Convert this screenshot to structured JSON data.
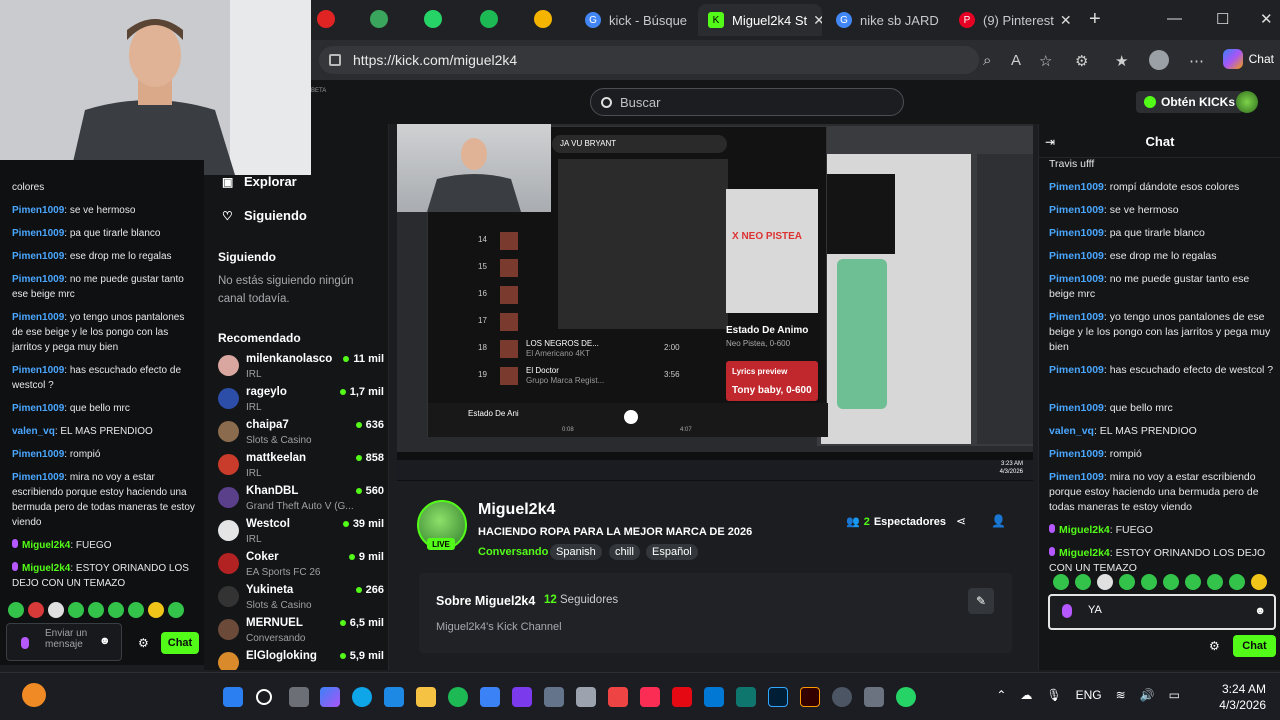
{
  "browser": {
    "tabs": [
      {
        "label": "kick - Búsque",
        "active": false
      },
      {
        "label": "Miguel2k4 St",
        "active": true
      },
      {
        "label": "nike sb JARD",
        "active": false
      },
      {
        "label": "(9) Pinterest",
        "active": false
      }
    ],
    "url": "https://kick.com/miguel2k4",
    "copilot_label": "Chat"
  },
  "header": {
    "beta": "BETA",
    "search_placeholder": "Buscar",
    "kicks_button": "Obtén KICKs"
  },
  "sidebar": {
    "explore": "Explorar",
    "following_link": "Siguiendo",
    "following_title": "Siguiendo",
    "no_following": "No estás siguiendo ningún canal todavía.",
    "recommended_title": "Recomendado",
    "recommended": [
      {
        "name": "milenkanolasco",
        "category": "IRL",
        "viewers": "11 mil",
        "color": "#d9a7a0"
      },
      {
        "name": "rageylo",
        "category": "IRL",
        "viewers": "1,7 mil",
        "color": "#2c4ea8"
      },
      {
        "name": "chaipa7",
        "category": "Slots & Casino",
        "viewers": "636",
        "color": "#8a6b4d"
      },
      {
        "name": "mattkeelan",
        "category": "IRL",
        "viewers": "858",
        "color": "#c93c2b"
      },
      {
        "name": "KhanDBL",
        "category": "Grand Theft Auto V (G...",
        "viewers": "560",
        "color": "#5a3f8a"
      },
      {
        "name": "Westcol",
        "category": "IRL",
        "viewers": "39 mil",
        "color": "#e5e5e5"
      },
      {
        "name": "Coker",
        "category": "EA Sports FC 26",
        "viewers": "9 mil",
        "color": "#b22222"
      },
      {
        "name": "Yukineta",
        "category": "Slots & Casino",
        "viewers": "266",
        "color": "#333"
      },
      {
        "name": "MERNUEL",
        "category": "Conversando",
        "viewers": "6,5 mil",
        "color": "#6b4a3a"
      },
      {
        "name": "ElGlogloking",
        "category": "",
        "viewers": "5,9 mil",
        "color": "#d98b2b"
      }
    ]
  },
  "left_chat": {
    "messages": [
      {
        "user": "",
        "text": "colores",
        "style": "blue"
      },
      {
        "user": "Pimen1009",
        "text": ": se ve hermoso",
        "style": "blue"
      },
      {
        "user": "Pimen1009",
        "text": ": pa que tirarle blanco",
        "style": "blue"
      },
      {
        "user": "Pimen1009",
        "text": ": ese drop me lo regalas",
        "style": "blue"
      },
      {
        "user": "Pimen1009",
        "text": ": no me puede gustar tanto ese beige mrc",
        "style": "blue"
      },
      {
        "user": "Pimen1009",
        "text": ": yo tengo unos pantalones de ese beige y le los pongo con las jarritos y pega muy bien",
        "style": "blue"
      },
      {
        "user": "Pimen1009",
        "text": ": has escuchado efecto de westcol ?",
        "style": "blue"
      },
      {
        "user": "Pimen1009",
        "text": ": que bello mrc",
        "style": "blue"
      },
      {
        "user": "valen_vq",
        "text": ": EL MAS PRENDIOO",
        "style": "blue"
      },
      {
        "user": "Pimen1009",
        "text": ": rompió",
        "style": "blue"
      },
      {
        "user": "Pimen1009",
        "text": ": mira no voy a estar escribiendo porque estoy haciendo una bermuda pero de todas maneras te estoy viendo",
        "style": "blue"
      },
      {
        "user": "Miguel2k4",
        "text": ": FUEGO",
        "style": "green"
      },
      {
        "user": "Miguel2k4",
        "text": ": ESTOY ORINANDO LOS DEJO CON UN TEMAZO",
        "style": "green"
      }
    ],
    "input_placeholder": "Enviar un mensaje",
    "send_label": "Chat"
  },
  "player": {
    "spotify_search": "JA VU BRYANT",
    "tracks": [
      {
        "n": "14",
        "title": ""
      },
      {
        "n": "15",
        "title": ""
      },
      {
        "n": "16",
        "title": ""
      },
      {
        "n": "17",
        "title": ""
      },
      {
        "n": "18",
        "title": "LOS NEGROS DE...",
        "artist": "El Americano 4KT",
        "dur": "2:00"
      },
      {
        "n": "19",
        "title": "El Doctor",
        "artist": "Grupo Marca Regist...",
        "dur": "3:56"
      }
    ],
    "album_title": "Estado De Animo",
    "album_artist": "Neo Pistea, 0-600",
    "lyrics_preview": "Lyrics preview",
    "lyrics_line": "Tony baby, 0-600",
    "now_playing": "Estado De Ani",
    "time_current": "0:08",
    "time_total": "4:07",
    "album_art_text": "X NEO PISTEA",
    "clock_time": "3:23 AM",
    "clock_date": "4/3/2026"
  },
  "channel": {
    "name": "Miguel2k4",
    "live": "LIVE",
    "title": "HACIENDO ROPA PARA LA MEJOR MARCA DE 2026",
    "category": "Conversando",
    "tags": [
      "Spanish",
      "chill",
      "Español"
    ],
    "viewers_count": "2",
    "viewers_label": "Espectadores"
  },
  "about": {
    "title": "Sobre Miguel2k4",
    "followers_count": "12",
    "followers_label": "Seguidores",
    "description": "Miguel2k4's Kick Channel"
  },
  "chat": {
    "title": "Chat",
    "messages": [
      {
        "user": "",
        "text": "Travis ufff",
        "style": "blue"
      },
      {
        "user": "Pimen1009",
        "text": ": rompí dándote esos colores",
        "style": "blue"
      },
      {
        "user": "Pimen1009",
        "text": ": se ve hermoso",
        "style": "blue"
      },
      {
        "user": "Pimen1009",
        "text": ": pa que tirarle blanco",
        "style": "blue"
      },
      {
        "user": "Pimen1009",
        "text": ": ese drop me lo regalas",
        "style": "blue"
      },
      {
        "user": "Pimen1009",
        "text": ": no me puede gustar tanto ese beige mrc",
        "style": "blue"
      },
      {
        "user": "Pimen1009",
        "text": ": yo tengo unos pantalones de ese beige y le los pongo con las jarritos y pega muy bien",
        "style": "blue"
      },
      {
        "user": "Pimen1009",
        "text": ": has escuchado efecto de westcol ?",
        "style": "blue"
      },
      {
        "user": "Pimen1009",
        "text": ": que bello mrc",
        "style": "blue"
      },
      {
        "user": "valen_vq",
        "text": ": EL MAS PRENDIOO",
        "style": "blue"
      },
      {
        "user": "Pimen1009",
        "text": ": rompió",
        "style": "blue"
      },
      {
        "user": "Pimen1009",
        "text": ": mira no voy a estar escribiendo porque estoy haciendo una bermuda pero de todas maneras te estoy viendo",
        "style": "blue"
      },
      {
        "user": "Miguel2k4",
        "text": ": FUEGO",
        "style": "green"
      },
      {
        "user": "Miguel2k4",
        "text": ": ESTOY ORINANDO LOS DEJO CON UN TEMAZO",
        "style": "green"
      }
    ],
    "input_value": "YA",
    "send_label": "Chat"
  },
  "taskbar": {
    "lang": "ENG",
    "time": "3:24 AM",
    "date": "4/3/2026"
  },
  "colors": {
    "accent": "#53fc18",
    "user_blue": "#4aa7ff",
    "background": "#141517"
  }
}
